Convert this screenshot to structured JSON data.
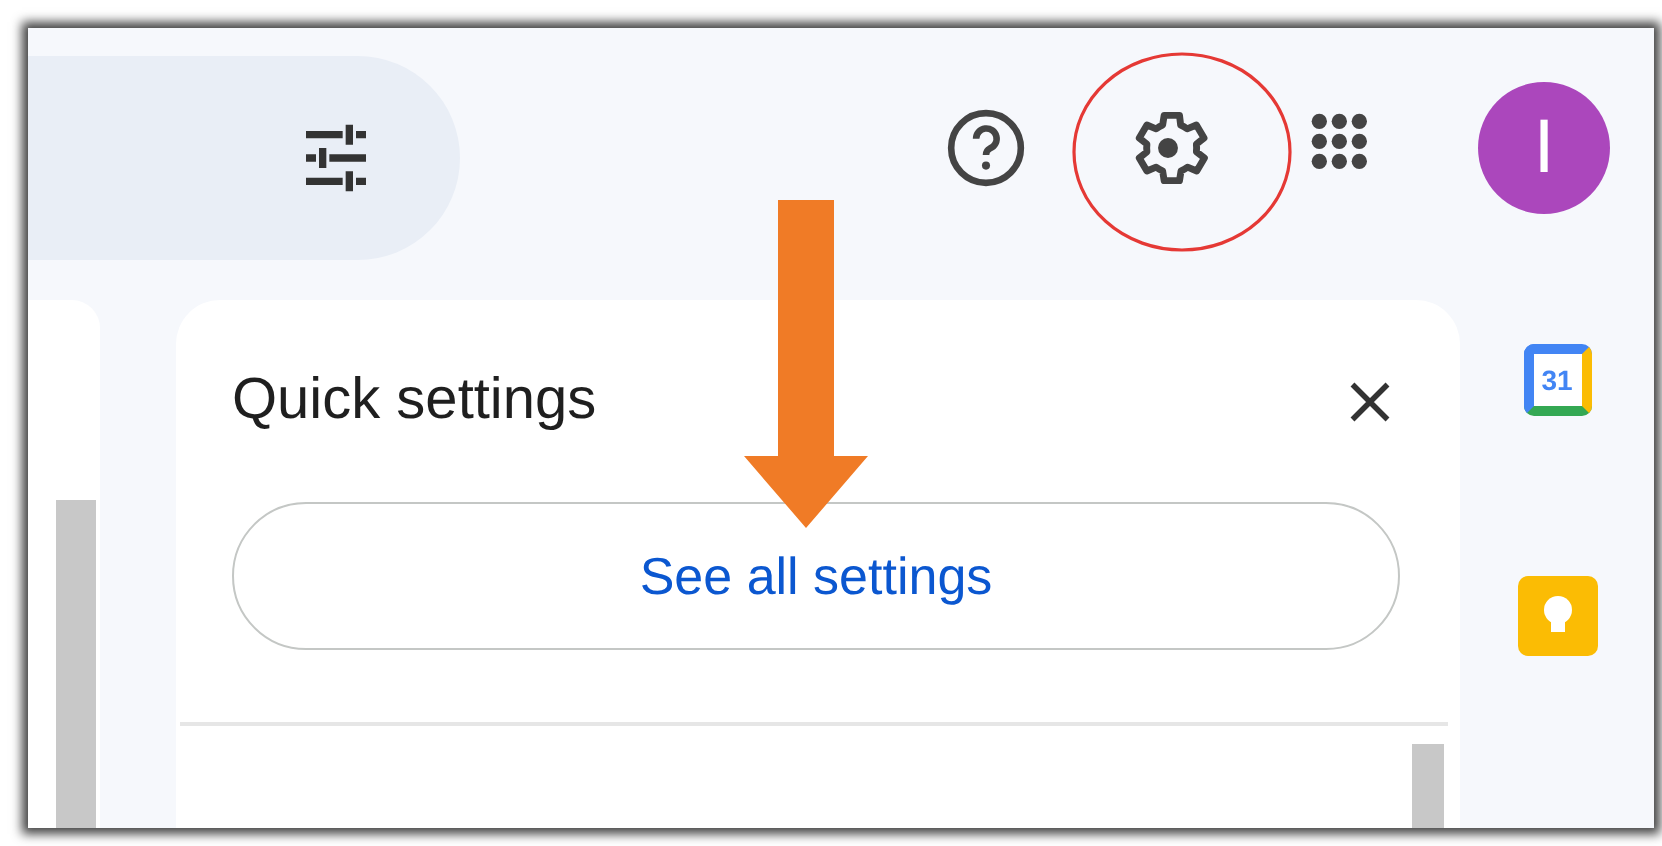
{
  "header": {
    "avatar": {
      "letter": "I"
    }
  },
  "quick_settings": {
    "title": "Quick settings",
    "button": "See all settings"
  },
  "side_panel": {
    "apps": [
      {
        "kind": "calendar",
        "label": "31"
      },
      {
        "kind": "keep"
      }
    ]
  }
}
